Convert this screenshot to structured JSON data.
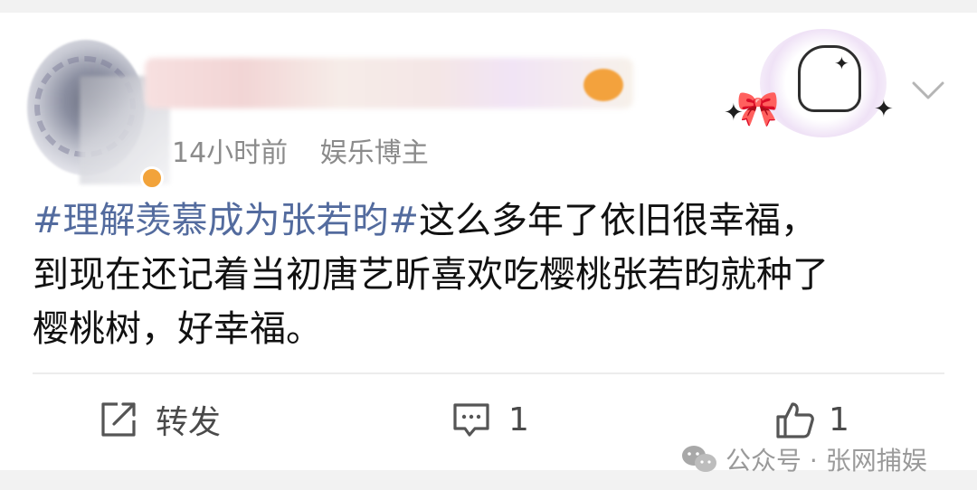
{
  "post": {
    "time": "14小时前",
    "user_label": "娱乐博主",
    "topic": "#理解羡慕成为张若昀#",
    "body_line1": "这么多年了依旧很幸福，",
    "body_line2": "到现在还记着当初唐艺昕喜欢吃樱桃张若昀就种了",
    "body_line3": "樱桃树，好幸福。"
  },
  "actions": {
    "repost_label": "转发",
    "comment_count": "1",
    "like_count": "1"
  },
  "watermark": {
    "text": "公众号 · 张网捕娱"
  },
  "icons": {
    "repost": "repost-icon",
    "comment": "comment-icon",
    "like": "thumbs-up-icon",
    "more": "chevron-down-icon",
    "wechat": "wechat-icon"
  },
  "colors": {
    "topic": "#536b9e",
    "text": "#111111",
    "meta": "#8b8b8b",
    "background": "#f2f2f2"
  }
}
